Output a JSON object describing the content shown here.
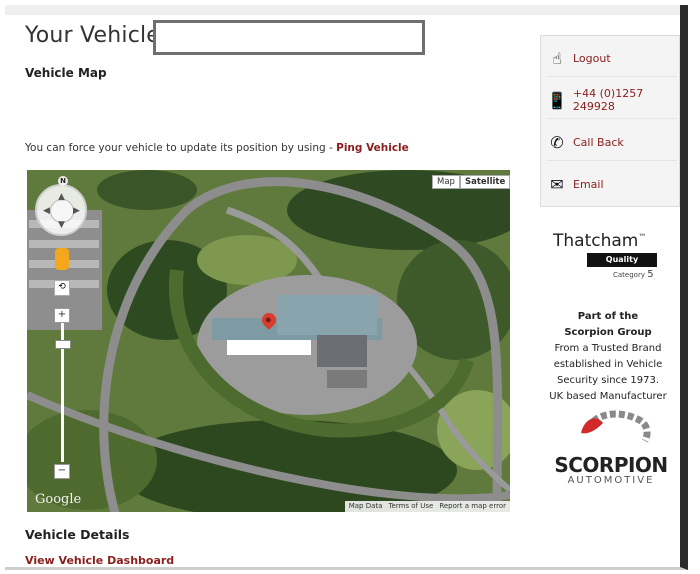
{
  "header": {
    "title": "Your Vehicle:",
    "vehicle_field_value": ""
  },
  "map_section": {
    "heading": "Vehicle Map",
    "ping_prefix": "You can force your vehicle to update its position by using - ",
    "ping_link": "Ping Vehicle"
  },
  "map": {
    "type_buttons": [
      "Map",
      "Satellite"
    ],
    "selected_type": "Satellite",
    "compass_n": "N",
    "zoom_in": "+",
    "zoom_out": "−",
    "logo": "Google",
    "footer_links": [
      "Map Data",
      "Terms of Use",
      "Report a map error"
    ]
  },
  "details": {
    "heading": "Vehicle Details",
    "dashboard_link": "View Vehicle Dashboard"
  },
  "sidebar": {
    "items": [
      {
        "label": "Logout",
        "icon": "hand-pointer-icon"
      },
      {
        "label": "+44 (0)1257 249928",
        "icon": "phone-icon"
      },
      {
        "label": "Call Back",
        "icon": "call-back-icon"
      },
      {
        "label": "Email",
        "icon": "envelope-icon"
      }
    ]
  },
  "badges": {
    "thatcham_name": "Thatcham",
    "thatcham_tm": "™",
    "quality_assured": "Quality Assured",
    "category_label": "Category",
    "category_number": "5"
  },
  "group": {
    "line1": "Part of the",
    "line2": "Scorpion Group",
    "line3": "From a Trusted Brand",
    "line4": "established in Vehicle",
    "line5": "Security since 1973.",
    "line6": "UK based Manufacturer"
  },
  "scorpion": {
    "brand": "SCORPION",
    "sub": "AUTOMOTIVE"
  },
  "colors": {
    "link": "#8b1d1d",
    "accent_red": "#d22a2a"
  }
}
